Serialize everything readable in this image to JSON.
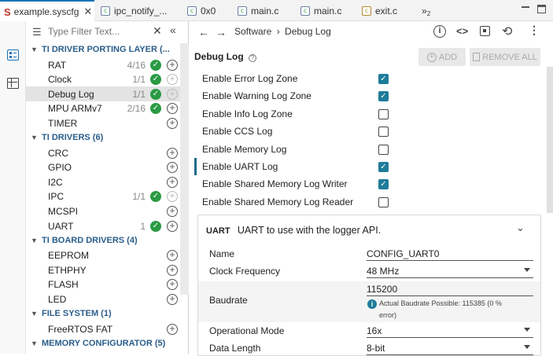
{
  "tabs": [
    {
      "label": "example.syscfg",
      "active": true
    },
    {
      "label": "ipc_notify_..."
    },
    {
      "label": "0x0"
    },
    {
      "label": "main.c"
    },
    {
      "label": "main.c"
    },
    {
      "label": "exit.c"
    },
    {
      "label": "»"
    },
    {
      "label": "2"
    }
  ],
  "filter": {
    "placeholder": "Type Filter Text..."
  },
  "categories": [
    {
      "title": "TI DRIVER PORTING LAYER (...",
      "items": [
        {
          "label": "RAT",
          "count": "4/16",
          "ok": true
        },
        {
          "label": "Clock",
          "count": "1/1",
          "ok": true
        },
        {
          "label": "Debug Log",
          "count": "1/1",
          "ok": true,
          "selected": true
        },
        {
          "label": "MPU ARMv7",
          "count": "2/16",
          "ok": true
        },
        {
          "label": "TIMER",
          "count": "",
          "ok": false
        }
      ]
    },
    {
      "title": "TI DRIVERS (6)",
      "items": [
        {
          "label": "CRC",
          "count": "",
          "ok": false
        },
        {
          "label": "GPIO",
          "count": "",
          "ok": false
        },
        {
          "label": "I2C",
          "count": "",
          "ok": false
        },
        {
          "label": "IPC",
          "count": "1/1",
          "ok": true
        },
        {
          "label": "MCSPI",
          "count": "",
          "ok": false
        },
        {
          "label": "UART",
          "count": "1",
          "ok": true
        }
      ]
    },
    {
      "title": "TI BOARD DRIVERS (4)",
      "items": [
        {
          "label": "EEPROM",
          "count": "",
          "ok": false
        },
        {
          "label": "ETHPHY",
          "count": "",
          "ok": false
        },
        {
          "label": "FLASH",
          "count": "",
          "ok": false
        },
        {
          "label": "LED",
          "count": "",
          "ok": false
        }
      ]
    },
    {
      "title": "FILE SYSTEM (1)",
      "items": [
        {
          "label": "FreeRTOS FAT",
          "count": "",
          "ok": false
        }
      ]
    },
    {
      "title": "MEMORY CONFIGURATOR (5)",
      "items": []
    }
  ],
  "breadcrumb": {
    "root": "Software",
    "sep": "›",
    "leaf": "Debug Log"
  },
  "module": {
    "title": "Debug Log",
    "add_label": "ADD",
    "remove_all_label": "REMOVE ALL"
  },
  "options": [
    {
      "label": "Enable Error Log Zone",
      "checked": true
    },
    {
      "label": "Enable Warning Log Zone",
      "checked": true
    },
    {
      "label": "Enable Info Log Zone",
      "checked": false
    },
    {
      "label": "Enable CCS Log",
      "checked": false
    },
    {
      "label": "Enable Memory Log",
      "checked": false
    },
    {
      "label": "Enable UART Log",
      "checked": true
    },
    {
      "label": "Enable Shared Memory Log Writer",
      "checked": true
    },
    {
      "label": "Enable Shared Memory Log Reader",
      "checked": false
    }
  ],
  "uart": {
    "tag": "UART",
    "desc": "UART to use with the logger API.",
    "name_label": "Name",
    "name_value": "CONFIG_UART0",
    "clock_label": "Clock Frequency",
    "clock_value": "48 MHz",
    "baud_label": "Baudrate",
    "baud_value": "115200",
    "baud_info_1": "Actual Baudrate Possible: 115385 (0 %",
    "baud_info_2": "error)",
    "opmode_label": "Operational Mode",
    "opmode_value": "16x",
    "datalen_label": "Data Length",
    "datalen_value": "8-bit"
  },
  "colors": {
    "accent": "#1e7c9a",
    "ok": "#2a9a43",
    "category": "#2a5d8a"
  }
}
